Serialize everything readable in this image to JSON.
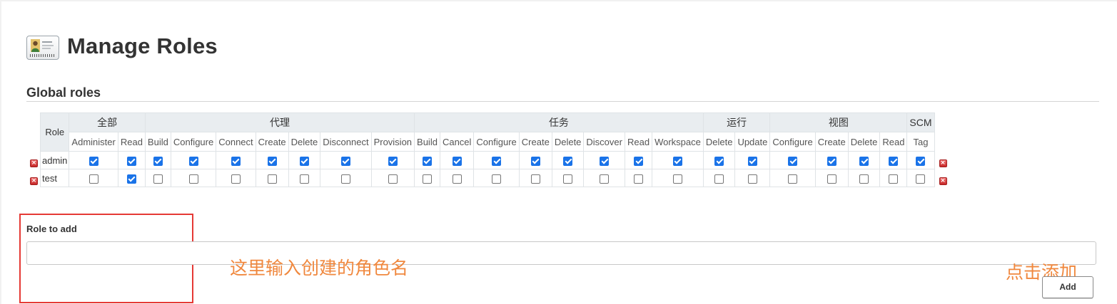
{
  "page": {
    "title": "Manage Roles",
    "section_title": "Global roles"
  },
  "table": {
    "role_header": "Role",
    "groups": [
      {
        "label": "全部",
        "span": 2
      },
      {
        "label": "代理",
        "span": 7
      },
      {
        "label": "任务",
        "span": 8
      },
      {
        "label": "运行",
        "span": 2
      },
      {
        "label": "视图",
        "span": 4
      },
      {
        "label": "SCM",
        "span": 1
      }
    ],
    "permissions": [
      "Administer",
      "Read",
      "Build",
      "Configure",
      "Connect",
      "Create",
      "Delete",
      "Disconnect",
      "Provision",
      "Build",
      "Cancel",
      "Configure",
      "Create",
      "Delete",
      "Discover",
      "Read",
      "Workspace",
      "Delete",
      "Update",
      "Configure",
      "Create",
      "Delete",
      "Read",
      "Tag"
    ],
    "rows": [
      {
        "name": "admin",
        "perms": [
          true,
          true,
          true,
          true,
          true,
          true,
          true,
          true,
          true,
          true,
          true,
          true,
          true,
          true,
          true,
          true,
          true,
          true,
          true,
          true,
          true,
          true,
          true,
          true
        ]
      },
      {
        "name": "test",
        "perms": [
          false,
          true,
          false,
          false,
          false,
          false,
          false,
          false,
          false,
          false,
          false,
          false,
          false,
          false,
          false,
          false,
          false,
          false,
          false,
          false,
          false,
          false,
          false,
          false
        ]
      }
    ]
  },
  "add_role": {
    "label": "Role to add",
    "value": "",
    "button_label": "Add"
  },
  "annotations": {
    "input_hint": "这里输入创建的角色名",
    "button_hint": "点击添加",
    "color": "#f0883e",
    "box_color": "#e53935"
  },
  "colors": {
    "checkbox_on": "#1a73e8",
    "header_bg": "#e9edf0",
    "delete_icon": "#c62828"
  }
}
